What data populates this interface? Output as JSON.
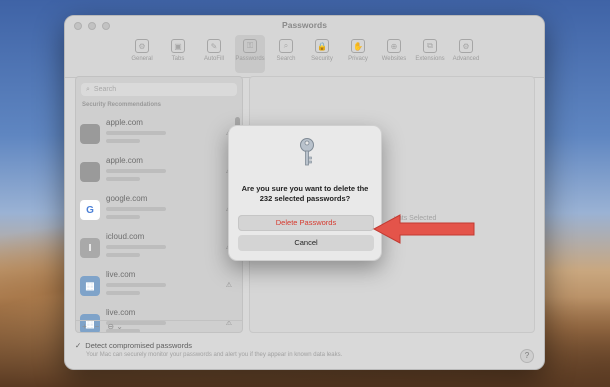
{
  "window": {
    "title": "Passwords",
    "toolbar": [
      {
        "label": "General",
        "icon": "gear-icon",
        "glyph": "⚙"
      },
      {
        "label": "Tabs",
        "icon": "tabs-icon",
        "glyph": "▣"
      },
      {
        "label": "AutoFill",
        "icon": "pencil-icon",
        "glyph": "✎"
      },
      {
        "label": "Passwords",
        "icon": "key-icon",
        "glyph": "⚿"
      },
      {
        "label": "Search",
        "icon": "magnifier-icon",
        "glyph": "⌕"
      },
      {
        "label": "Security",
        "icon": "lock-icon",
        "glyph": "🔒"
      },
      {
        "label": "Privacy",
        "icon": "hand-icon",
        "glyph": "✋"
      },
      {
        "label": "Websites",
        "icon": "globe-icon",
        "glyph": "⊕"
      },
      {
        "label": "Extensions",
        "icon": "puzzle-icon",
        "glyph": "⧉"
      },
      {
        "label": "Advanced",
        "icon": "gears-icon",
        "glyph": "⚙"
      }
    ],
    "active_tab": "Passwords"
  },
  "sidebar": {
    "search_placeholder": "Search",
    "section_heading": "Security Recommendations",
    "rows": [
      {
        "site": "apple.com",
        "icon_glyph": "",
        "icon_bg": "#9a9a9a"
      },
      {
        "site": "apple.com",
        "icon_glyph": "",
        "icon_bg": "#9a9a9a"
      },
      {
        "site": "google.com",
        "icon_glyph": "G",
        "icon_bg": "#ffffff"
      },
      {
        "site": "icloud.com",
        "icon_glyph": "I",
        "icon_bg": "#a9a9a9"
      },
      {
        "site": "live.com",
        "icon_glyph": "▦",
        "icon_bg": "#7fa3c9"
      },
      {
        "site": "live.com",
        "icon_glyph": "▦",
        "icon_bg": "#7fa3c9"
      }
    ],
    "bottom": {
      "add": "+",
      "remove": "−",
      "more": "⊖ ⌄"
    }
  },
  "detail": {
    "placeholder": "unts Selected"
  },
  "footer": {
    "checkbox_label": "Detect compromised passwords",
    "subtitle": "Your Mac can securely monitor your passwords and alert you if they appear in known data leaks.",
    "help": "?"
  },
  "dialog": {
    "message": "Are you sure you want to delete the 232 selected passwords?",
    "delete_label": "Delete Passwords",
    "cancel_label": "Cancel"
  },
  "colors": {
    "accent_delete": "#d63a2f",
    "arrow": "#e4544a"
  }
}
